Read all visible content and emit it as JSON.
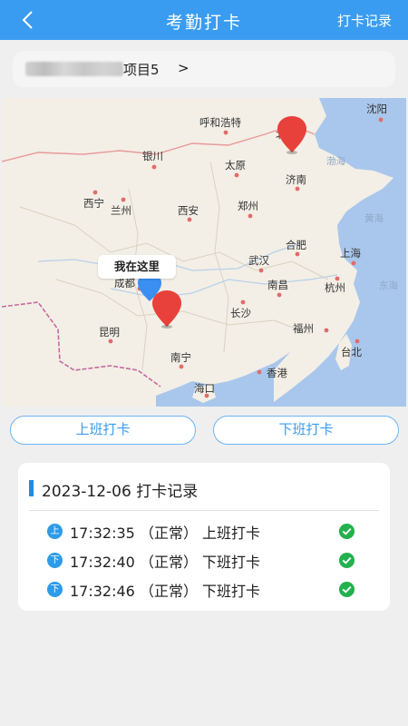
{
  "header": {
    "title": "考勤打卡",
    "right_action": "打卡记录",
    "back_icon": "chevron-left-icon"
  },
  "project": {
    "name": "项目5",
    "arrow": ">"
  },
  "map": {
    "here_label": "我在这里",
    "cities": [
      "沈阳",
      "呼和浩特",
      "北京",
      "银川",
      "太原",
      "渤海",
      "济南",
      "西宁",
      "兰州",
      "西安",
      "郑州",
      "黄海",
      "合肥",
      "上海",
      "武汉",
      "成都",
      "南昌",
      "杭州",
      "东海",
      "长沙",
      "昆明",
      "福州",
      "台北",
      "南宁",
      "香港",
      "海口"
    ],
    "colors": {
      "marker_red": "#e8413b",
      "marker_blue": "#3b8ef2",
      "sea": "#a9c7ec",
      "land": "#f3efe6"
    }
  },
  "buttons": {
    "clock_in": "上班打卡",
    "clock_out": "下班打卡"
  },
  "records": {
    "title": "2023-12-06 打卡记录",
    "items": [
      {
        "badge": "上",
        "text": "17:32:35 （正常） 上班打卡",
        "status_icon": "check-circle-icon"
      },
      {
        "badge": "下",
        "text": "17:32:40 （正常） 下班打卡",
        "status_icon": "check-circle-icon"
      },
      {
        "badge": "下",
        "text": "17:32:46 （正常） 下班打卡",
        "status_icon": "check-circle-icon"
      }
    ]
  },
  "colors": {
    "accent": "#3a9cf0",
    "success": "#22b14c",
    "background": "#efefef"
  }
}
